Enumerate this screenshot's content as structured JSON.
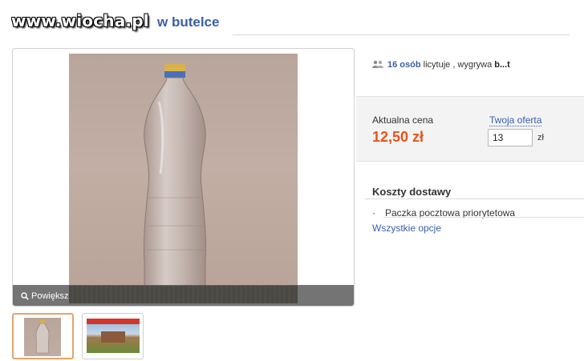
{
  "watermark": "www.wiocha.pl",
  "listing": {
    "title_fragment": "w butelce"
  },
  "gallery": {
    "zoom_label": "Powiększ",
    "thumbnails": [
      "bottle-photo",
      "building-photo"
    ]
  },
  "bidders": {
    "count": "16 osób",
    "text": "licytuje , wygrywa",
    "winner": "b...t"
  },
  "price": {
    "current_label": "Aktualna cena",
    "current_value": "12,50 zł",
    "offer_label": "Twoja oferta",
    "offer_value": "13",
    "offer_unit": "zł"
  },
  "shipping": {
    "title": "Koszty dostawy",
    "items": [
      "Paczka pocztowa priorytetowa"
    ],
    "all_options": "Wszystkie opcje"
  },
  "colors": {
    "link": "#3a5ea8",
    "price": "#e8541c",
    "thumb_selected": "#e8a36a"
  }
}
